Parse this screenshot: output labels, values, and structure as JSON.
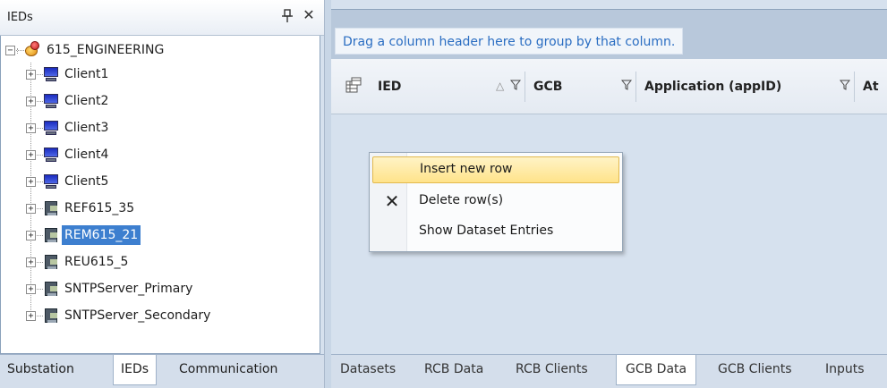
{
  "left_panel": {
    "title": "IEDs",
    "pin_glyph": "ф",
    "close_glyph": "✕",
    "root": {
      "label": "615_ENGINEERING",
      "expander": "−",
      "icon": "engineering-icon"
    },
    "items": [
      {
        "label": "Client1",
        "icon": "monitor-icon",
        "expander": "+"
      },
      {
        "label": "Client2",
        "icon": "monitor-icon",
        "expander": "+"
      },
      {
        "label": "Client3",
        "icon": "monitor-icon",
        "expander": "+"
      },
      {
        "label": "Client4",
        "icon": "monitor-icon",
        "expander": "+"
      },
      {
        "label": "Client5",
        "icon": "monitor-icon",
        "expander": "+"
      },
      {
        "label": "REF615_35",
        "icon": "device-icon",
        "expander": "+"
      },
      {
        "label": "REM615_21",
        "icon": "device-icon",
        "expander": "+",
        "selected": true
      },
      {
        "label": "REU615_5",
        "icon": "device-icon",
        "expander": "+"
      },
      {
        "label": "SNTPServer_Primary",
        "icon": "device-icon",
        "expander": "+"
      },
      {
        "label": "SNTPServer_Secondary",
        "icon": "device-icon",
        "expander": "+"
      }
    ],
    "tabs": [
      {
        "label": "Substation"
      },
      {
        "label": "IEDs",
        "active": true
      },
      {
        "label": "Communication"
      }
    ]
  },
  "grid": {
    "group_hint": "Drag a column header here to group by that column.",
    "columns": [
      {
        "label": "IED",
        "sort_glyph": "△"
      },
      {
        "label": "GCB"
      },
      {
        "label": "Application (appID)"
      },
      {
        "label": "At"
      }
    ],
    "filter_glyph": "▽",
    "tabs": [
      {
        "label": "Datasets"
      },
      {
        "label": "RCB Data"
      },
      {
        "label": "RCB Clients"
      },
      {
        "label": "GCB Data",
        "active": true
      },
      {
        "label": "GCB Clients"
      },
      {
        "label": "Inputs"
      }
    ]
  },
  "context_menu": {
    "items": [
      {
        "label": "Insert new row",
        "highlighted": true
      },
      {
        "label": "Delete row(s)",
        "icon_glyph": "✕"
      },
      {
        "label": "Show Dataset Entries"
      }
    ]
  },
  "colors": {
    "selection": "#3d7fcf",
    "link_text": "#2a6dc2",
    "menu_highlight": "#ffe38a"
  }
}
